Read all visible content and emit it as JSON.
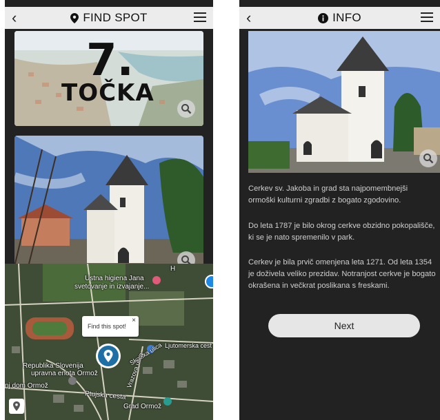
{
  "left_screen": {
    "header": {
      "title": "FIND SPOT",
      "icon": "map-pin-icon",
      "back_icon": "chevron-left-icon",
      "menu_icon": "hamburger-menu-icon"
    },
    "point_card": {
      "number": "7.",
      "word": "TOČKA"
    },
    "map": {
      "popup_text": "Find this spot!",
      "popup_close": "×",
      "labels": {
        "health_1": "Ustna higiena Jana",
        "health_2": "svetovanje in izvajanje...",
        "street_skolska": "Skolska ulica",
        "street_vrazova": "Vrazova ulica",
        "street_ljutomerska": "Ljutomerska cest",
        "republika_1": "Republika Slovenija",
        "republika_2": "upravna enota Ormož",
        "dom": "nj dom Ormož",
        "ptujska": "Ptujska cesta",
        "grad": "Grad Ormož",
        "h_label": "H"
      }
    }
  },
  "right_screen": {
    "header": {
      "title": "INFO",
      "icon": "info-circle-icon",
      "back_icon": "chevron-left-icon",
      "menu_icon": "hamburger-menu-icon"
    },
    "paragraphs": [
      "Cerkev sv. Jakoba in grad sta najpomembnejši ormoški kulturni zgradbi z bogato zgodovino.",
      "Do leta 1787 je bilo okrog cerkve obzidno pokopališče, ki se je nato spremenilo v park.",
      "Cerkev je bila prvič omenjena leta 1271. Od leta 1354 je doživela veliko prezidav. Notranjost cerkve je bogato okrašena in večkrat poslikana s freskami."
    ],
    "next_label": "Next"
  },
  "colors": {
    "header_bg": "#ececec",
    "screen_bg": "#222222",
    "map_pin": "#1e6fa6",
    "button_bg": "#e6e6e6"
  }
}
